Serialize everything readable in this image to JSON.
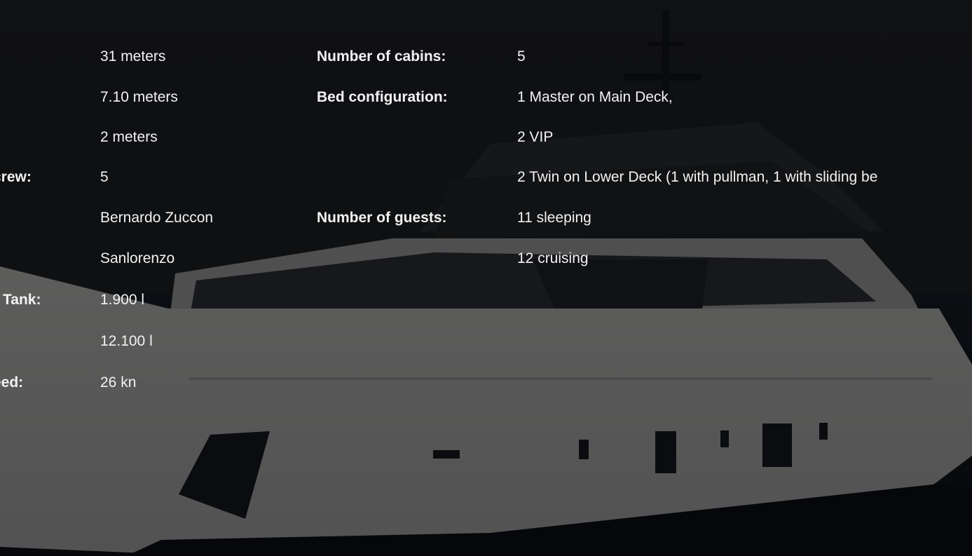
{
  "colors": {
    "sky": "#26292e",
    "sea": "#151b24",
    "hull": "#e8e8e6",
    "overlay": "#000000",
    "text": "#f2f2f2"
  },
  "left_specs": {
    "row_crew_label": "crew:",
    "row_tank_label": "r Tank:",
    "row_speed_label": "eed:",
    "length": "31 meters",
    "beam": "7.10 meters",
    "draft": "2 meters",
    "crew": "5",
    "designer": "Bernardo Zuccon",
    "builder": "Sanlorenzo",
    "water_tank": "1.900 l",
    "fuel_tank": "12.100 l",
    "speed": " 26 kn"
  },
  "right_specs": {
    "cabins_label": "Number of cabins:",
    "cabins_value": "5",
    "bed_label": "Bed configuration:",
    "bed_line_1": "1 Master on Main Deck,",
    "bed_line_2": "2 VIP",
    "bed_line_3": "2 Twin on Lower Deck (1 with pullman, 1 with sliding be",
    "guests_label": "Number of guests:",
    "guests_sleeping": "11 sleeping",
    "guests_cruising": "12 cruising"
  }
}
